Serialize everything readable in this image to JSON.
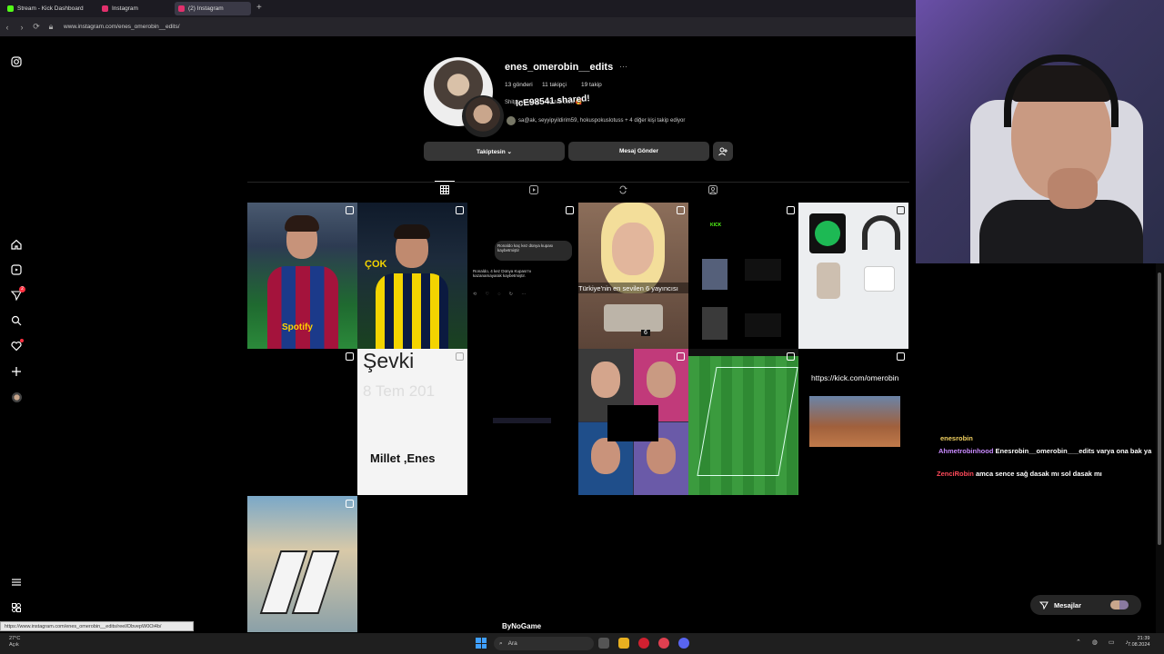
{
  "browser": {
    "tabs": [
      {
        "label": "Stream - Kick Dashboard",
        "color": "#53fc18"
      },
      {
        "label": "Instagram",
        "color": "#e1306c"
      },
      {
        "label": "(2) Instagram",
        "color": "#e1306c"
      }
    ],
    "new_tab": "+",
    "url": "www.instagram.com/enes_omerobin__edits/",
    "status_url": "https://www.instagram.com/enes_omerobin__edits/reel/DbvepW0Oi4b/"
  },
  "sidebar": {
    "icons": [
      "instagram-logo-icon",
      "home-icon",
      "reels-icon",
      "messages-icon",
      "search-icon",
      "notifications-icon",
      "create-icon",
      "profile-avatar",
      "menu-icon",
      "more-icon"
    ],
    "messages_badge": "2"
  },
  "profile": {
    "username": "enes_omerobin__edits",
    "more": "···",
    "posts": "13 gönderi",
    "followers": "11 takipçi",
    "following": "19 takip",
    "bio": "Shitpost hesap • destek olun 🥰",
    "followed_by": "sa@ak, seyyipyildirim59, hokuspokuslotuss + 4 diğer kişi takip ediyor",
    "shared_overlay": "IcE98541 shared!",
    "follow_button": "Takiptesin ⌄",
    "message_button": "Mesaj Gönder",
    "add_person": "⁺⁸"
  },
  "grid": {
    "tile3_bubble": "Ronaldo kaç kez dünya kupası kaybetmiştir",
    "tile3_reply": "Ronaldo, 4 kez Dünya Kupası'nı kazanamayarak kaybetmiştir.",
    "tile4_caption": "Türkiye'nin en sevilen 6 yayıncısı",
    "tile5_logo": "KICK",
    "tile8_title": "Şevki",
    "tile8_date": "8 Tem 201",
    "tile8_bottom": "Millet ,Enes",
    "tile12_link": "https://kick.com/omerobin"
  },
  "chat": [
    {
      "user": "enesrobin",
      "text": ""
    },
    {
      "user": "Ahmetrobinhood",
      "text": "Enesrobin__omerobin___edits varya ona bak ya"
    },
    {
      "user": "ZenciRobin",
      "text": "amca sence sağ dasak mı sol dasak mı"
    }
  ],
  "messages_pill": "Mesajlar",
  "watermark": "ByNoGame",
  "taskbar": {
    "weather": "27°C",
    "weather_sub": "Açık",
    "search": "Ara",
    "time": "21:39",
    "date": "7.08.2024"
  }
}
